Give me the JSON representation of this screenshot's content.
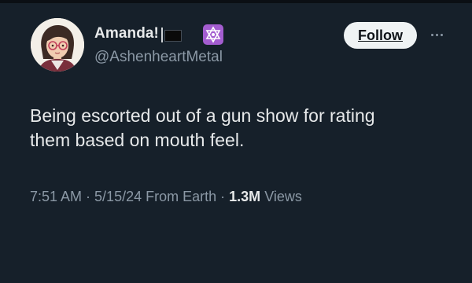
{
  "author": {
    "display_name": "Amanda!",
    "handle": "@AshenheartMetal",
    "avatar_icon": "cartoon-avatar-with-glasses",
    "name_emojis": [
      "black-flag-icon",
      "star-of-david-icon"
    ],
    "badge_color": "#a45dd0"
  },
  "actions": {
    "follow_label": "Follow",
    "more_icon": "ellipsis-icon"
  },
  "tweet": {
    "text": "Being escorted out of a gun show for rating\nthem based on mouth feel."
  },
  "meta": {
    "time": "7:51 AM",
    "separator": " · ",
    "date": "5/15/24",
    "source": "From Earth",
    "views_count": "1.3M",
    "views_label": "Views"
  },
  "colors": {
    "background": "#16202a",
    "text_primary": "#e7e9ea",
    "text_secondary": "#8b98a5",
    "follow_bg": "#eff3f4"
  }
}
